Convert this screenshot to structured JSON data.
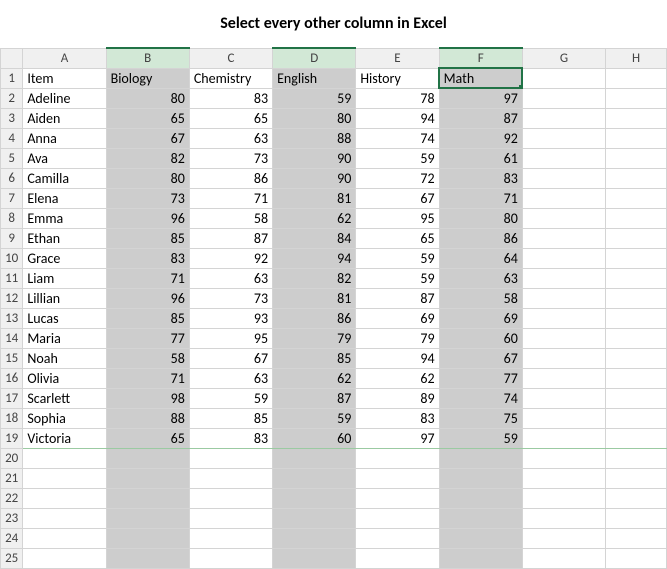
{
  "title": "Select every other column in Excel",
  "col_letters": [
    "A",
    "B",
    "C",
    "D",
    "E",
    "F",
    "G",
    "H"
  ],
  "selected_cols": [
    1,
    3,
    5
  ],
  "headers": [
    "Item",
    "Biology",
    "Chemistry",
    "English",
    "History",
    "Math"
  ],
  "rows": [
    {
      "name": "Adeline",
      "v": [
        80,
        83,
        59,
        78,
        97
      ]
    },
    {
      "name": "Aiden",
      "v": [
        65,
        65,
        80,
        94,
        87
      ]
    },
    {
      "name": "Anna",
      "v": [
        67,
        63,
        88,
        74,
        92
      ]
    },
    {
      "name": "Ava",
      "v": [
        82,
        73,
        90,
        59,
        61
      ]
    },
    {
      "name": "Camilla",
      "v": [
        80,
        86,
        90,
        72,
        83
      ]
    },
    {
      "name": "Elena",
      "v": [
        73,
        71,
        81,
        67,
        71
      ]
    },
    {
      "name": "Emma",
      "v": [
        96,
        58,
        62,
        95,
        80
      ]
    },
    {
      "name": "Ethan",
      "v": [
        85,
        87,
        84,
        65,
        86
      ]
    },
    {
      "name": "Grace",
      "v": [
        83,
        92,
        94,
        59,
        64
      ]
    },
    {
      "name": "Liam",
      "v": [
        71,
        63,
        82,
        59,
        63
      ]
    },
    {
      "name": "Lillian",
      "v": [
        96,
        73,
        81,
        87,
        58
      ]
    },
    {
      "name": "Lucas",
      "v": [
        85,
        93,
        86,
        69,
        69
      ]
    },
    {
      "name": "Maria",
      "v": [
        77,
        95,
        79,
        79,
        60
      ]
    },
    {
      "name": "Noah",
      "v": [
        58,
        67,
        85,
        94,
        67
      ]
    },
    {
      "name": "Olivia",
      "v": [
        71,
        63,
        62,
        62,
        77
      ]
    },
    {
      "name": "Scarlett",
      "v": [
        98,
        59,
        87,
        89,
        74
      ]
    },
    {
      "name": "Sophia",
      "v": [
        88,
        85,
        59,
        83,
        75
      ]
    },
    {
      "name": "Victoria",
      "v": [
        65,
        83,
        60,
        97,
        59
      ]
    }
  ],
  "blank_rows": [
    20,
    21,
    22,
    23,
    24,
    25
  ],
  "chart_data": {
    "type": "table",
    "title": "Select every other column in Excel",
    "columns": [
      "Item",
      "Biology",
      "Chemistry",
      "English",
      "History",
      "Math"
    ],
    "data": [
      [
        "Adeline",
        80,
        83,
        59,
        78,
        97
      ],
      [
        "Aiden",
        65,
        65,
        80,
        94,
        87
      ],
      [
        "Anna",
        67,
        63,
        88,
        74,
        92
      ],
      [
        "Ava",
        82,
        73,
        90,
        59,
        61
      ],
      [
        "Camilla",
        80,
        86,
        90,
        72,
        83
      ],
      [
        "Elena",
        73,
        71,
        81,
        67,
        71
      ],
      [
        "Emma",
        96,
        58,
        62,
        95,
        80
      ],
      [
        "Ethan",
        85,
        87,
        84,
        65,
        86
      ],
      [
        "Grace",
        83,
        92,
        94,
        59,
        64
      ],
      [
        "Liam",
        71,
        63,
        82,
        59,
        63
      ],
      [
        "Lillian",
        96,
        73,
        81,
        87,
        58
      ],
      [
        "Lucas",
        85,
        93,
        86,
        69,
        69
      ],
      [
        "Maria",
        77,
        95,
        79,
        79,
        60
      ],
      [
        "Noah",
        58,
        67,
        85,
        94,
        67
      ],
      [
        "Olivia",
        71,
        63,
        62,
        62,
        77
      ],
      [
        "Scarlett",
        98,
        59,
        87,
        89,
        74
      ],
      [
        "Sophia",
        88,
        85,
        59,
        83,
        75
      ],
      [
        "Victoria",
        65,
        83,
        60,
        97,
        59
      ]
    ]
  }
}
